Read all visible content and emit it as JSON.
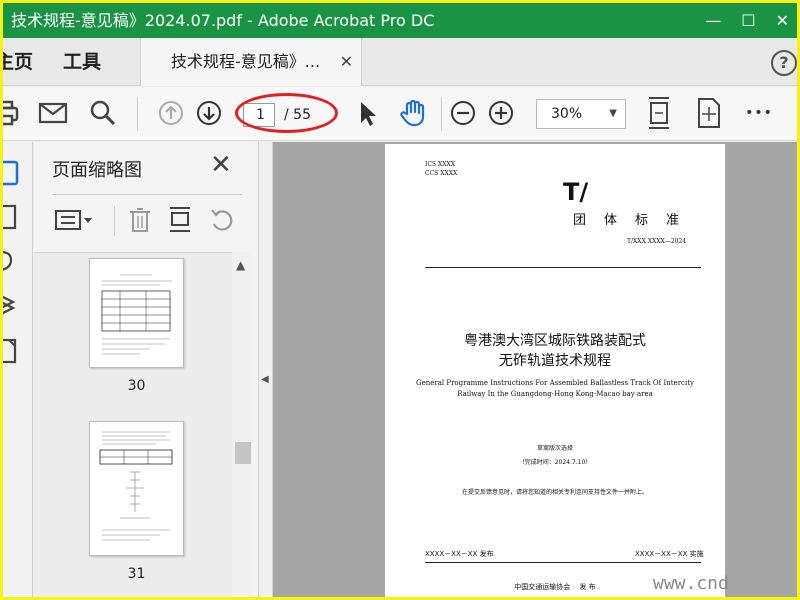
{
  "window": {
    "title": "技术规程-意见稿》2024.07.pdf - Adobe Acrobat Pro DC",
    "minimize_glyph": "—",
    "maximize_glyph": "☐",
    "close_glyph": "✕",
    "titlebar_color": "#1a9444",
    "frame_color": "#f4f219"
  },
  "tabs": {
    "home": "主页",
    "tools": "工具",
    "document": "技术规程-意见稿》...",
    "close_glyph": "✕",
    "help_glyph": "?"
  },
  "toolbar": {
    "current_page": "1",
    "total_pages": "/ 55",
    "zoom": "30%",
    "zoom_caret": "▼",
    "more_glyph": "•••",
    "highlight_color": "#e02020",
    "hand_color": "#1e6fd6"
  },
  "panel": {
    "title": "页面缩略图",
    "close_glyph": "✕",
    "collapse_glyph": "◀",
    "scroll_up_glyph": "▲",
    "thumbnails": [
      {
        "page": "30"
      },
      {
        "page": "31"
      }
    ]
  },
  "document": {
    "ics": "ICS  XXXX",
    "ccs": "CCS  XXXX",
    "logo": "T/",
    "standard_type": "团体标准",
    "standard_no": "T/XXX XXXX—2024",
    "title_line1": "粤港澳大湾区城际铁路装配式",
    "title_line2": "无砟轨道技术规程",
    "en_line1": "General Programme Instructions For Assembled Ballastless Track Of Intercity",
    "en_line2": "Railway In the Guangdong-Hong Kong-Macao bay area",
    "draft_label": "草案版次选择",
    "draft_date": "（完成时间：2024.7.10）",
    "notice": "在提交反馈意见时，请将您知道的相关专利连同支持性文件一并附上。",
    "publish": "XXXX－XX－XX 发布",
    "implement": "XXXX－XX－XX 实施",
    "issuer": "中国交通运输协会　 发 布"
  },
  "watermark": "www.cnd"
}
